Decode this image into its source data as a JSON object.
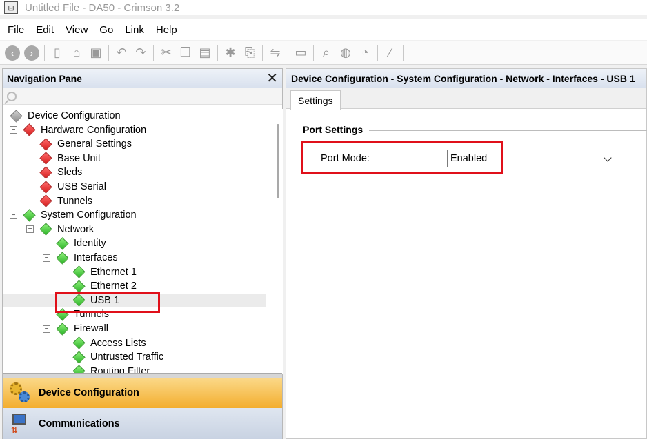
{
  "window": {
    "title": "Untitled File - DA50 - Crimson 3.2",
    "app_icon": "app-icon"
  },
  "menu": [
    "File",
    "Edit",
    "View",
    "Go",
    "Link",
    "Help"
  ],
  "toolbar": [
    "back-icon",
    "forward-icon",
    "new-icon",
    "open-icon",
    "save-icon",
    "undo-icon",
    "redo-icon",
    "cut-icon",
    "copy-icon",
    "paste-icon",
    "find-icon",
    "replace-icon",
    "link-icon",
    "screen-icon",
    "search-doc-icon",
    "globe-icon",
    "doc-icon",
    "wand-icon"
  ],
  "nav": {
    "header": "Navigation Pane",
    "close": "✕",
    "tree": [
      {
        "label": "Device Configuration",
        "color": "gray",
        "level": 0,
        "expander": ""
      },
      {
        "label": "Hardware Configuration",
        "color": "red",
        "level": 0,
        "expander": "−"
      },
      {
        "label": "General Settings",
        "color": "red",
        "level": 1,
        "expander": ""
      },
      {
        "label": "Base Unit",
        "color": "red",
        "level": 1,
        "expander": ""
      },
      {
        "label": "Sleds",
        "color": "red",
        "level": 1,
        "expander": ""
      },
      {
        "label": "USB Serial",
        "color": "red",
        "level": 1,
        "expander": ""
      },
      {
        "label": "Tunnels",
        "color": "red",
        "level": 1,
        "expander": ""
      },
      {
        "label": "System Configuration",
        "color": "green",
        "level": 0,
        "expander": "−"
      },
      {
        "label": "Network",
        "color": "green",
        "level": 1,
        "expander": "−"
      },
      {
        "label": "Identity",
        "color": "green",
        "level": 2,
        "expander": ""
      },
      {
        "label": "Interfaces",
        "color": "green",
        "level": 2,
        "expander": "−"
      },
      {
        "label": "Ethernet 1",
        "color": "green",
        "level": 3,
        "expander": ""
      },
      {
        "label": "Ethernet 2",
        "color": "green",
        "level": 3,
        "expander": ""
      },
      {
        "label": "USB 1",
        "color": "green",
        "level": 3,
        "expander": "",
        "selected": true
      },
      {
        "label": "Tunnels",
        "color": "green",
        "level": 2,
        "expander": ""
      },
      {
        "label": "Firewall",
        "color": "green",
        "level": 2,
        "expander": "−"
      },
      {
        "label": "Access Lists",
        "color": "green",
        "level": 3,
        "expander": ""
      },
      {
        "label": "Untrusted Traffic",
        "color": "green",
        "level": 3,
        "expander": ""
      },
      {
        "label": "Routing Filter",
        "color": "green",
        "level": 3,
        "expander": ""
      }
    ],
    "buttons": [
      {
        "label": "Device Configuration",
        "icon": "gear-icon",
        "active": true
      },
      {
        "label": "Communications",
        "icon": "communications-icon",
        "active": false
      }
    ]
  },
  "content": {
    "breadcrumb": "Device Configuration - System Configuration - Network - Interfaces - USB 1",
    "tab": "Settings",
    "group": "Port Settings",
    "field_label": "Port Mode:",
    "field_value": "Enabled"
  },
  "colors": {
    "highlight": "#e0101a",
    "active_button": "#f3ae2e"
  }
}
